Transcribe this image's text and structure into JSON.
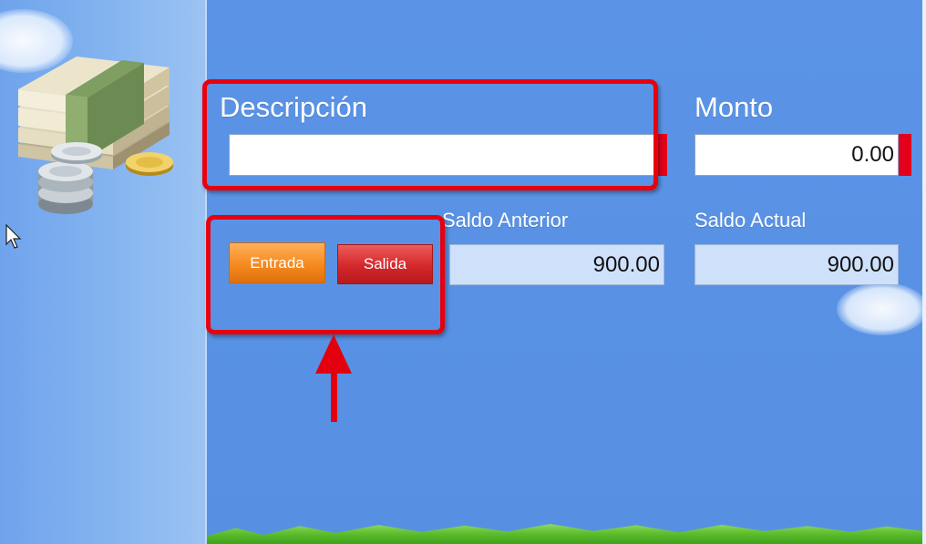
{
  "form": {
    "descripcion": {
      "label": "Descripción",
      "value": ""
    },
    "monto": {
      "label": "Monto",
      "value": "0.00"
    },
    "saldo_anterior": {
      "label": "Saldo Anterior",
      "value": "900.00"
    },
    "saldo_actual": {
      "label": "Saldo Actual",
      "value": "900.00"
    }
  },
  "buttons": {
    "entrada": "Entrada",
    "salida": "Salida"
  },
  "colors": {
    "background": "#5a93e4",
    "annotation": "#e8000f",
    "entrada": "#f58a1f",
    "salida": "#d3272b",
    "required_marker": "#e3001b"
  },
  "icons": {
    "logo": "money-stack-icon",
    "annotation": "red-arrow-icon",
    "cursor": "mouse-pointer-icon"
  }
}
